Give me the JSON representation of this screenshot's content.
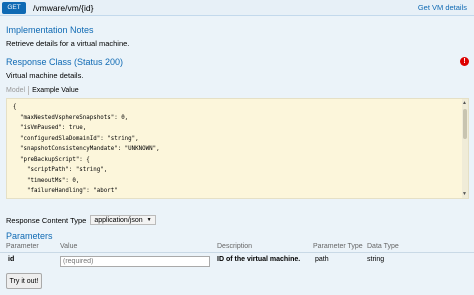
{
  "header": {
    "method": "GET",
    "path": "/vmware/vm/{id}",
    "summary": "Get VM details"
  },
  "implementation": {
    "heading": "Implementation Notes",
    "text": "Retrieve details for a virtual machine."
  },
  "response_class": {
    "heading": "Response Class (Status 200)",
    "text": "Virtual machine details."
  },
  "tabs": {
    "model": "Model",
    "example": "Example Value"
  },
  "example_lines": [
    "{",
    "  \"maxNestedVsphereSnapshots\": 0,",
    "  \"isVmPaused\": true,",
    "  \"configuredSlaDomainId\": \"string\",",
    "  \"snapshotConsistencyMandate\": \"UNKNOWN\",",
    "  \"preBackupScript\": {",
    "    \"scriptPath\": \"string\",",
    "    \"timeoutMs\": 0,",
    "    \"failureHandling\": \"abort\"",
    "  },"
  ],
  "response_content_type": {
    "label": "Response Content Type",
    "selected": "application/json"
  },
  "parameters": {
    "heading": "Parameters",
    "columns": [
      "Parameter",
      "Value",
      "Description",
      "Parameter Type",
      "Data Type"
    ],
    "rows": [
      {
        "name": "id",
        "placeholder": "(required)",
        "description": "ID of the virtual machine.",
        "param_type": "path",
        "data_type": "string"
      }
    ]
  },
  "try_button": "Try it out!"
}
